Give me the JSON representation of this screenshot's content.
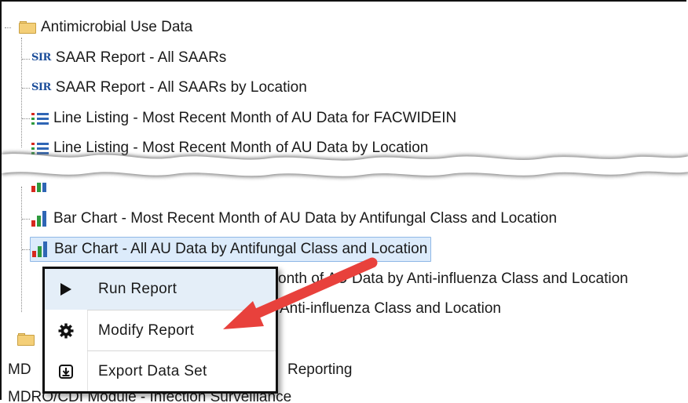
{
  "tree": {
    "folder_label": "Antimicrobial Use Data",
    "items": [
      {
        "icon": "sir-icon",
        "icon_text": "SIR",
        "label": "SAAR Report - All SAARs"
      },
      {
        "icon": "sir-icon",
        "icon_text": "SIR",
        "label": "SAAR Report - All SAARs by Location"
      },
      {
        "icon": "line-listing-icon",
        "label": "Line Listing - Most Recent Month of AU Data for FACWIDEIN"
      },
      {
        "icon": "line-listing-icon",
        "label": "Line Listing - Most Recent Month of AU Data by Location"
      },
      {
        "icon": "bar-chart-icon",
        "label": "Bar Chart - Most Recent Month of AU Data by Antifungal Class and Location"
      },
      {
        "icon": "bar-chart-icon",
        "label": "Bar Chart - All AU Data by Antifungal Class and Location",
        "selected": true
      },
      {
        "icon": "bar-chart-icon",
        "label": "onth of AU Data by Anti-influenza Class and Location"
      },
      {
        "icon": "bar-chart-icon",
        "label": "Anti-influenza Class and Location"
      }
    ],
    "bottom_rows": [
      {
        "label_left": "MD",
        "label_right": "Reporting"
      },
      {
        "label": "MDRO/CDI Module - Infection Surveillance"
      }
    ]
  },
  "context_menu": {
    "items": [
      {
        "icon": "play-icon",
        "label": "Run Report"
      },
      {
        "icon": "gear-icon",
        "label": "Modify Report"
      },
      {
        "icon": "export-icon",
        "label": "Export Data Set"
      }
    ]
  },
  "colors": {
    "selection_bg": "#dcebfb",
    "selection_border": "#8fb8e6",
    "sir_blue": "#1b4d9a",
    "arrow_red": "#e8413c",
    "bar_red": "#d7281e",
    "bar_green": "#2e9a3e",
    "bar_blue": "#2f66b5"
  }
}
